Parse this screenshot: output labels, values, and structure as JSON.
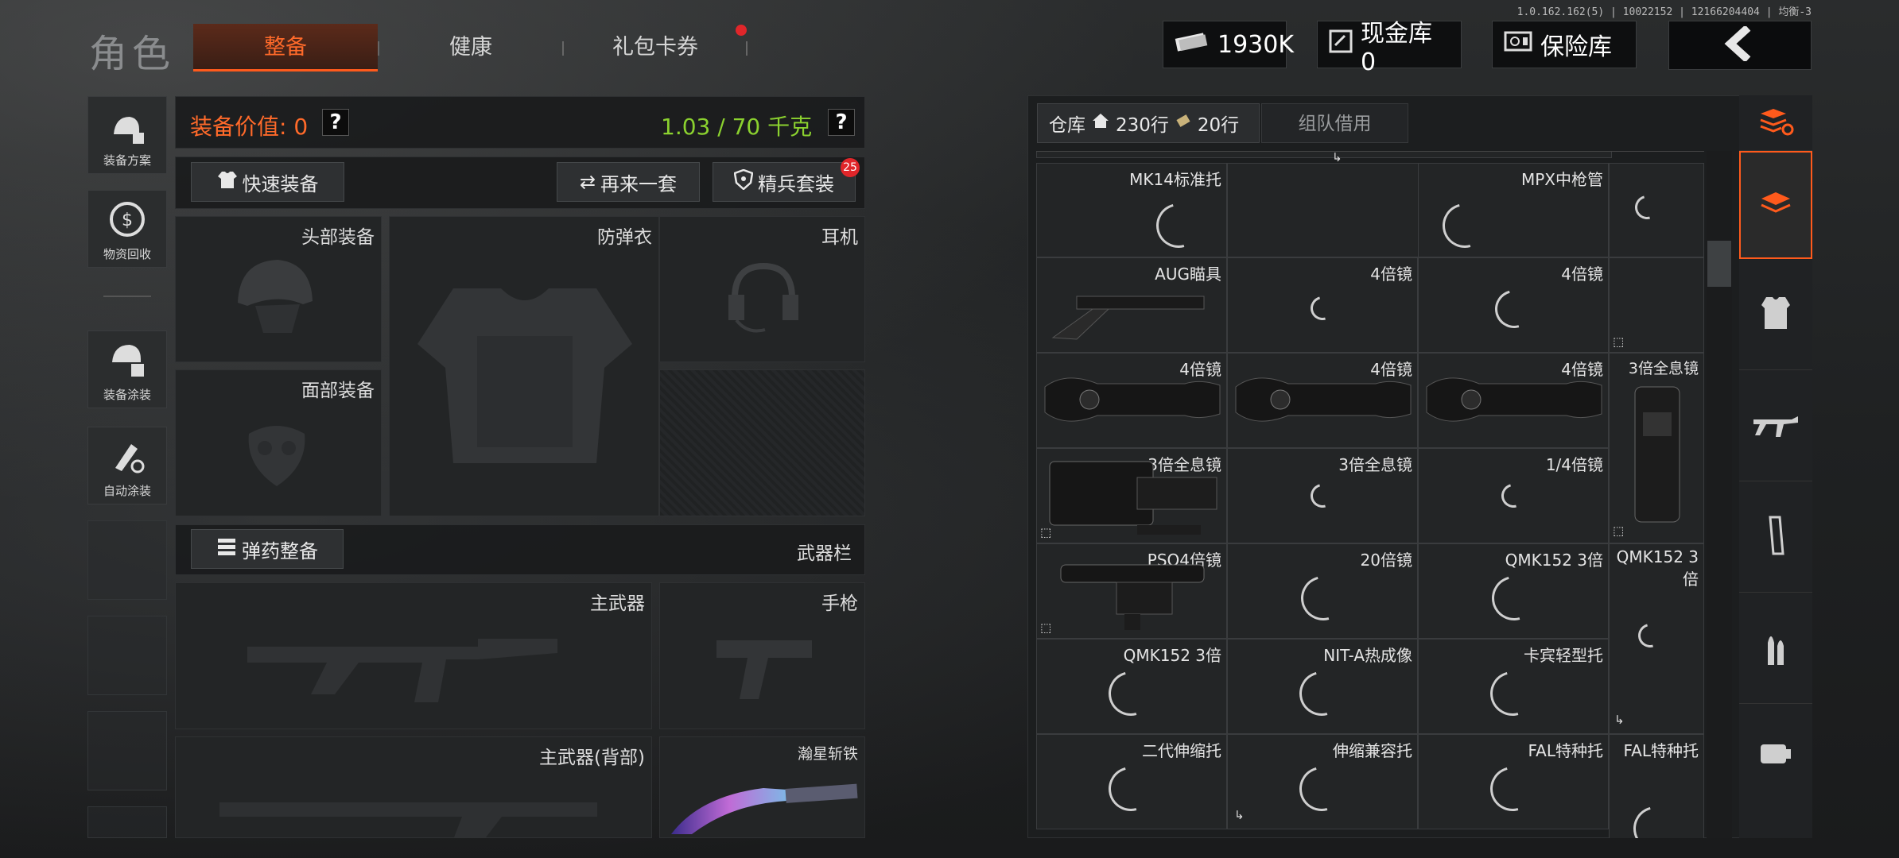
{
  "version": "1.0.162.162(5) | 10022152 | 12166204404 | 均衡-3",
  "app_title": "角色",
  "tabs": [
    {
      "label": "整备",
      "active": true
    },
    {
      "label": "健康",
      "active": false
    },
    {
      "label": "礼包卡券",
      "active": false
    }
  ],
  "currency": {
    "money": "1930K",
    "cash_vault": "现金库 0",
    "insurance": "保险库"
  },
  "sidebar": [
    {
      "label": "装备方案",
      "icon": "gear-plan-icon"
    },
    {
      "label": "物资回收",
      "icon": "recycle-icon"
    },
    {
      "label": "装备涂装",
      "icon": "paint-gear-icon"
    },
    {
      "label": "自动涂装",
      "icon": "auto-paint-icon"
    }
  ],
  "loadout": {
    "value_label": "装备价值: 0",
    "weight": "1.03 / 70 千克",
    "quick_equip": "快速装备",
    "reroll": "再来一套",
    "elite_kit": "精兵套装",
    "elite_badge": "25",
    "slots": {
      "head": "头部装备",
      "armor": "防弹衣",
      "headset": "耳机",
      "face": "面部装备",
      "ammo_equip": "弹药整备",
      "weapon_bar": "武器栏",
      "primary": "主武器",
      "pistol": "手枪",
      "primary_back": "主武器(背部)",
      "melee": "瀚星斩铁"
    }
  },
  "warehouse": {
    "tab_label": "仓库",
    "rows": "230行",
    "extra_rows": "20行",
    "team_tab": "组队借用",
    "cells": [
      [
        "MK14标准托",
        "MPX中枪管",
        ""
      ],
      [
        "AUG瞄具",
        "4倍镜",
        "4倍镜",
        ""
      ],
      [
        "4倍镜",
        "4倍镜",
        "4倍镜",
        "3倍全息镜"
      ],
      [
        "3倍全息镜",
        "3倍全息镜",
        "1/4倍镜"
      ],
      [
        "PSO4倍镜",
        "20倍镜",
        "QMK152 3倍",
        "QMK152 3倍"
      ],
      [
        "QMK152 3倍",
        "NIT-A热成像",
        "卡宾轻型托",
        ""
      ],
      [
        "二代伸缩托",
        "伸缩兼容托",
        "FAL特种托",
        "FAL特种托"
      ]
    ]
  },
  "colors": {
    "accent": "#ff5a1c",
    "weight_green": "#8bd12f",
    "value_orange": "#ff6a2a"
  }
}
